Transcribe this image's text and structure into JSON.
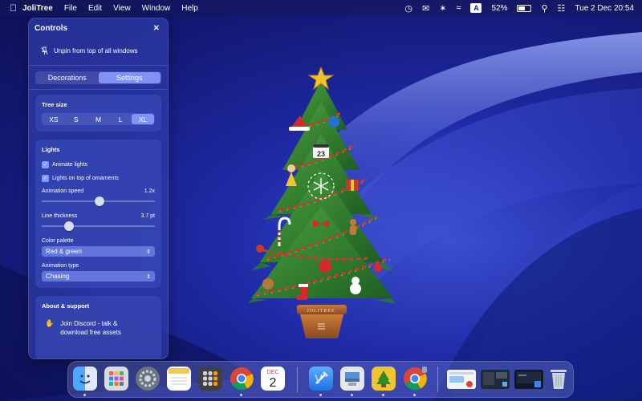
{
  "menubar": {
    "app_name": "JoliTree",
    "menus": [
      "File",
      "Edit",
      "View",
      "Window",
      "Help"
    ],
    "battery": "52%",
    "input_source": "A",
    "clock": "Tue 2 Dec  20:54"
  },
  "panel": {
    "title": "Controls",
    "unpin_label": "Unpin from top of all windows",
    "tabs": [
      {
        "label": "Decorations",
        "active": false
      },
      {
        "label": "Settings",
        "active": true
      }
    ],
    "tree_size": {
      "title": "Tree size",
      "options": [
        "XS",
        "S",
        "M",
        "L",
        "XL"
      ],
      "selected": "XL"
    },
    "lights": {
      "title": "Lights",
      "animate_lights": "Animate lights",
      "lights_on_top": "Lights on top of ornaments",
      "animation_speed_label": "Animation speed",
      "animation_speed_value": "1.2x",
      "animation_speed_fraction": 0.51,
      "line_thickness_label": "Line thickness",
      "line_thickness_value": "3.7 pt",
      "line_thickness_fraction": 0.24,
      "color_palette_label": "Color palette",
      "color_palette_value": "Red & green",
      "animation_type_label": "Animation type",
      "animation_type_value": "Chasing"
    },
    "support": {
      "title": "About & support",
      "discord_line1": "Join Discord - talk &",
      "discord_line2": "download free assets"
    }
  },
  "tree": {
    "calendar_day": "23",
    "pot_label": "JOLITREE"
  },
  "dock": {
    "calendar_month": "DEC",
    "calendar_day": "2",
    "apps": [
      "finder-icon",
      "launchpad-icon",
      "system-settings-icon",
      "notes-icon",
      "calculator-icon",
      "chrome-icon",
      "calendar-icon",
      "xcode-icon",
      "preview-icon",
      "jolitree-icon",
      "chrome-icon",
      "window-thumbnail",
      "window-thumbnail",
      "window-thumbnail",
      "trash-icon"
    ]
  },
  "colors": {
    "panel_bg": "#2d3aa5",
    "accent": "#8ca0ff",
    "tree_green": "#2f7d2c",
    "garland_red": "#d9342b",
    "pot_brown": "#b8642a"
  }
}
